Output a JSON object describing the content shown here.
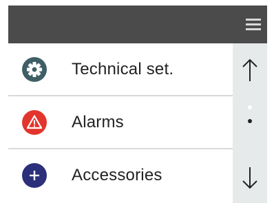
{
  "header": {
    "menu_icon": "hamburger-menu-icon"
  },
  "menu": {
    "items": [
      {
        "label": "Technical set.",
        "icon": "gear-icon",
        "color": "#3e5f65"
      },
      {
        "label": "Alarms",
        "icon": "warning-icon",
        "color": "#e2352d"
      },
      {
        "label": "Accessories",
        "icon": "plus-icon",
        "color": "#2c2f7a"
      }
    ]
  },
  "scrollbar": {
    "up_icon": "arrow-up-icon",
    "down_icon": "arrow-down-icon",
    "pages": 2,
    "current_page": 2
  },
  "colors": {
    "header_bg": "#4b4b4b",
    "scrollbar_bg": "#e6eaea"
  }
}
